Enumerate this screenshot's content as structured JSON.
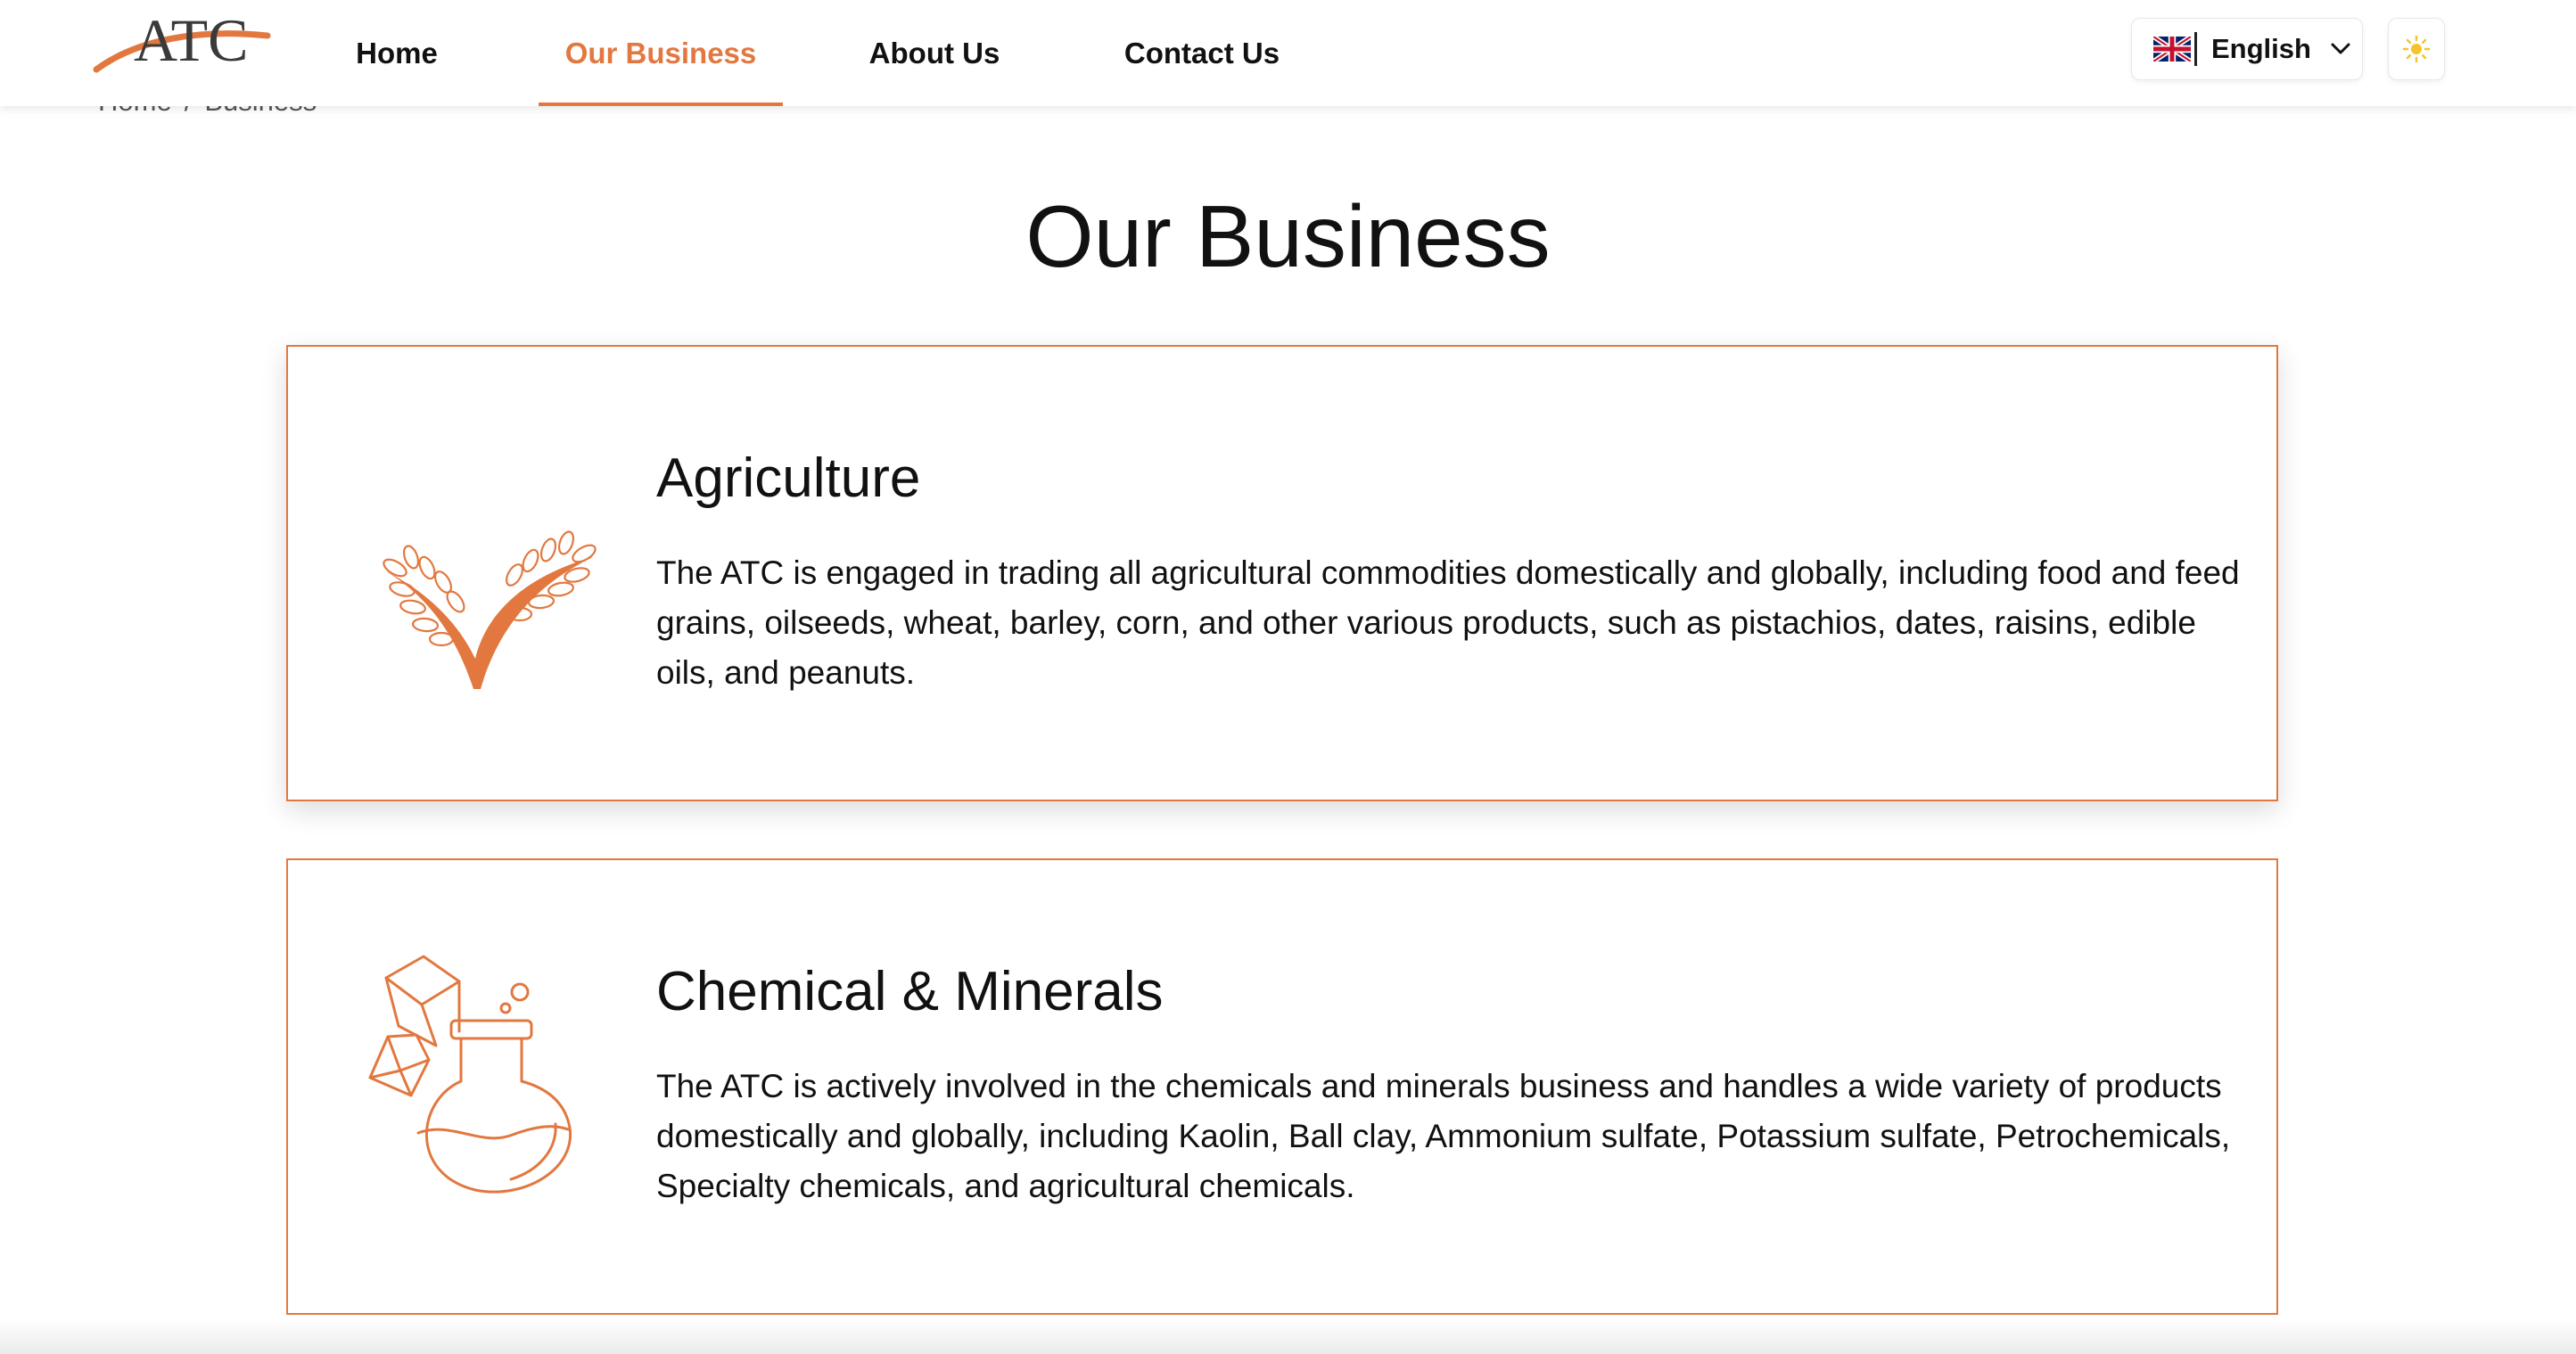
{
  "brand": {
    "logo_text": "ATC",
    "accent_color": "#E2783F"
  },
  "nav": {
    "items": [
      {
        "label": "Home",
        "active": false
      },
      {
        "label": "Our Business",
        "active": true
      },
      {
        "label": "About Us",
        "active": false
      },
      {
        "label": "Contact Us",
        "active": false
      }
    ]
  },
  "language": {
    "selected": "English",
    "flag_icon": "uk-flag-icon"
  },
  "theme_toggle": {
    "icon": "sun-icon"
  },
  "breadcrumb": {
    "home": "Home",
    "separator": "/",
    "current": "Business"
  },
  "page": {
    "title": "Our Business"
  },
  "businesses": [
    {
      "icon": "wheat-icon",
      "title": "Agriculture",
      "description": "The ATC is engaged in trading all agricultural commodities domestically and globally, including food and feed grains, oilseeds, wheat, barley, corn, and other various products, such as pistachios, dates, raisins, edible oils, and peanuts."
    },
    {
      "icon": "chemical-flask-icon",
      "title": "Chemical & Minerals",
      "description": "The ATC is actively involved in the chemicals and minerals business and handles a wide variety of products domestically and globally, including Kaolin, Ball clay, Ammonium sulfate, Potassium sulfate, Petrochemicals, Specialty chemicals, and agricultural chemicals."
    }
  ]
}
